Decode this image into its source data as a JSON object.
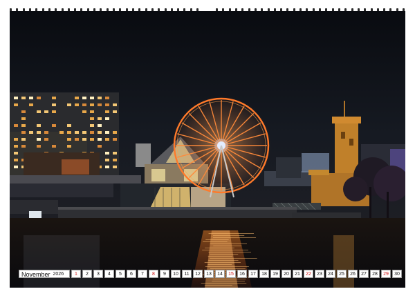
{
  "calendar": {
    "month": "November",
    "year": "2026",
    "days": [
      {
        "n": "1",
        "sun": true
      },
      {
        "n": "2",
        "sun": false
      },
      {
        "n": "3",
        "sun": false
      },
      {
        "n": "4",
        "sun": false
      },
      {
        "n": "5",
        "sun": false
      },
      {
        "n": "6",
        "sun": false
      },
      {
        "n": "7",
        "sun": false
      },
      {
        "n": "8",
        "sun": true
      },
      {
        "n": "9",
        "sun": false
      },
      {
        "n": "10",
        "sun": false
      },
      {
        "n": "11",
        "sun": false
      },
      {
        "n": "12",
        "sun": false
      },
      {
        "n": "13",
        "sun": false
      },
      {
        "n": "14",
        "sun": false
      },
      {
        "n": "15",
        "sun": true
      },
      {
        "n": "16",
        "sun": false
      },
      {
        "n": "17",
        "sun": false
      },
      {
        "n": "18",
        "sun": false
      },
      {
        "n": "19",
        "sun": false
      },
      {
        "n": "20",
        "sun": false
      },
      {
        "n": "21",
        "sun": false
      },
      {
        "n": "22",
        "sun": true
      },
      {
        "n": "23",
        "sun": false
      },
      {
        "n": "24",
        "sun": false
      },
      {
        "n": "25",
        "sun": false
      },
      {
        "n": "26",
        "sun": false
      },
      {
        "n": "27",
        "sun": false
      },
      {
        "n": "28",
        "sun": false
      },
      {
        "n": "29",
        "sun": true
      },
      {
        "n": "30",
        "sun": false
      }
    ]
  },
  "colors": {
    "sunday": "#d01a1a",
    "wheel_lights": "#ff7a2a",
    "sky": "#0b0d12",
    "water_reflection": "#ff8a2a"
  },
  "binding_ring_count": 62
}
